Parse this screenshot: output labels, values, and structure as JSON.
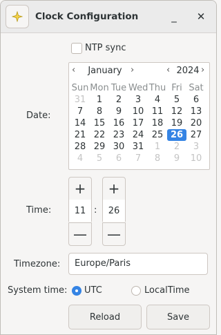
{
  "window": {
    "title": "Clock Configuration",
    "minimize_label": "_",
    "close_label": "✕"
  },
  "ntp": {
    "label": "NTP sync",
    "checked": false
  },
  "date": {
    "label": "Date:",
    "month": "January",
    "year": "2024",
    "prev_label": "‹",
    "next_label": "›",
    "weekdays": [
      "Sun",
      "Mon",
      "Tue",
      "Wed",
      "Thu",
      "Fri",
      "Sat"
    ],
    "weeks": [
      [
        "31",
        "1",
        "2",
        "3",
        "4",
        "5",
        "6"
      ],
      [
        "7",
        "8",
        "9",
        "10",
        "11",
        "12",
        "13"
      ],
      [
        "14",
        "15",
        "16",
        "17",
        "18",
        "19",
        "20"
      ],
      [
        "21",
        "22",
        "23",
        "24",
        "25",
        "26",
        "27"
      ],
      [
        "28",
        "29",
        "30",
        "31",
        "1",
        "2",
        "3"
      ],
      [
        "4",
        "5",
        "6",
        "7",
        "8",
        "9",
        "10"
      ]
    ],
    "selected_day": "26"
  },
  "time": {
    "label": "Time:",
    "hour": "11",
    "minute": "26",
    "separator": ":",
    "plus": "+",
    "minus": "—"
  },
  "timezone": {
    "label": "Timezone:",
    "value": "Europe/Paris"
  },
  "system_time": {
    "label": "System time:",
    "options": [
      "UTC",
      "LocalTime"
    ],
    "selected": "UTC"
  },
  "buttons": {
    "reload": "Reload",
    "save": "Save"
  },
  "colors": {
    "accent": "#3584e4"
  }
}
